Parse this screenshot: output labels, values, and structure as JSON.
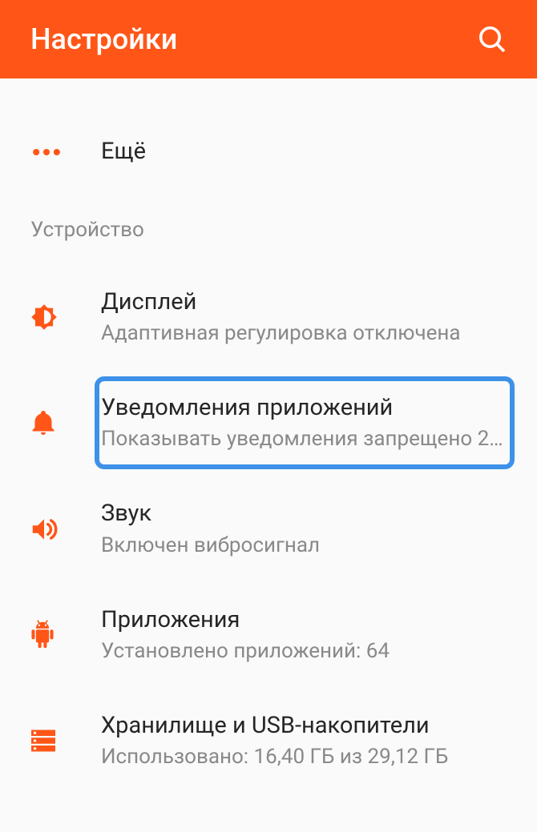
{
  "header": {
    "title": "Настройки"
  },
  "more": {
    "label": "Ещё"
  },
  "section_device": {
    "header": "Устройство",
    "items": [
      {
        "title": "Дисплей",
        "subtitle": "Адаптивная регулировка отключена"
      },
      {
        "title": "Уведомления приложений",
        "subtitle": "Показывать уведомления запрещено 2…"
      },
      {
        "title": "Звук",
        "subtitle": "Включен вибросигнал"
      },
      {
        "title": "Приложения",
        "subtitle": "Установлено приложений: 64"
      },
      {
        "title": "Хранилище и USB-накопители",
        "subtitle": "Использовано: 16,40 ГБ из 29,12 ГБ"
      }
    ]
  },
  "colors": {
    "accent": "#ff5618",
    "highlight": "#3d91e8"
  }
}
